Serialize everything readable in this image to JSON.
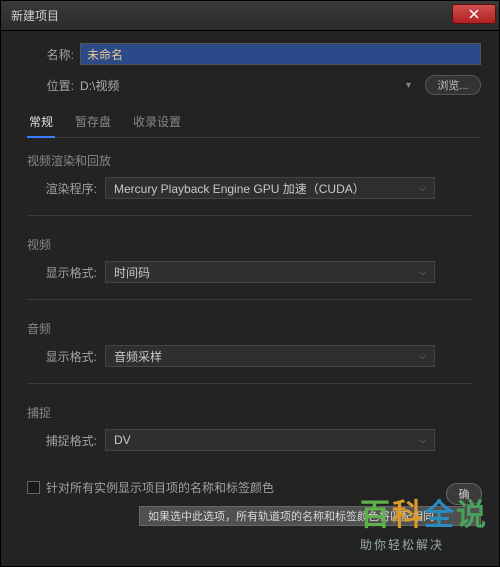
{
  "window": {
    "title": "新建项目"
  },
  "fields": {
    "name_label": "名称:",
    "name_value": "未命名",
    "location_label": "位置:",
    "location_value": "D:\\视频",
    "browse_label": "浏览..."
  },
  "tabs": [
    {
      "label": "常规",
      "active": true
    },
    {
      "label": "暂存盘",
      "active": false
    },
    {
      "label": "收录设置",
      "active": false
    }
  ],
  "sections": {
    "render": {
      "title": "视频渲染和回放",
      "renderer_label": "渲染程序:",
      "renderer_value": "Mercury Playback Engine GPU 加速（CUDA）"
    },
    "video": {
      "title": "视频",
      "format_label": "显示格式:",
      "format_value": "时间码"
    },
    "audio": {
      "title": "音频",
      "format_label": "显示格式:",
      "format_value": "音频采样"
    },
    "capture": {
      "title": "捕捉",
      "format_label": "捕捉格式:",
      "format_value": "DV"
    }
  },
  "checkbox": {
    "label": "针对所有实例显示项目项的名称和标签颜色"
  },
  "tooltip": "如果选中此选项，所有轨道项的名称和标签颜色将匹配相同",
  "footer_btn": "确",
  "watermark": {
    "chars": [
      "百",
      "科",
      "全",
      "说"
    ],
    "colors": [
      "#5fb04a",
      "#d99a2c",
      "#2a8bbf",
      "#4aa05a"
    ],
    "sub": "助你轻松解决"
  }
}
